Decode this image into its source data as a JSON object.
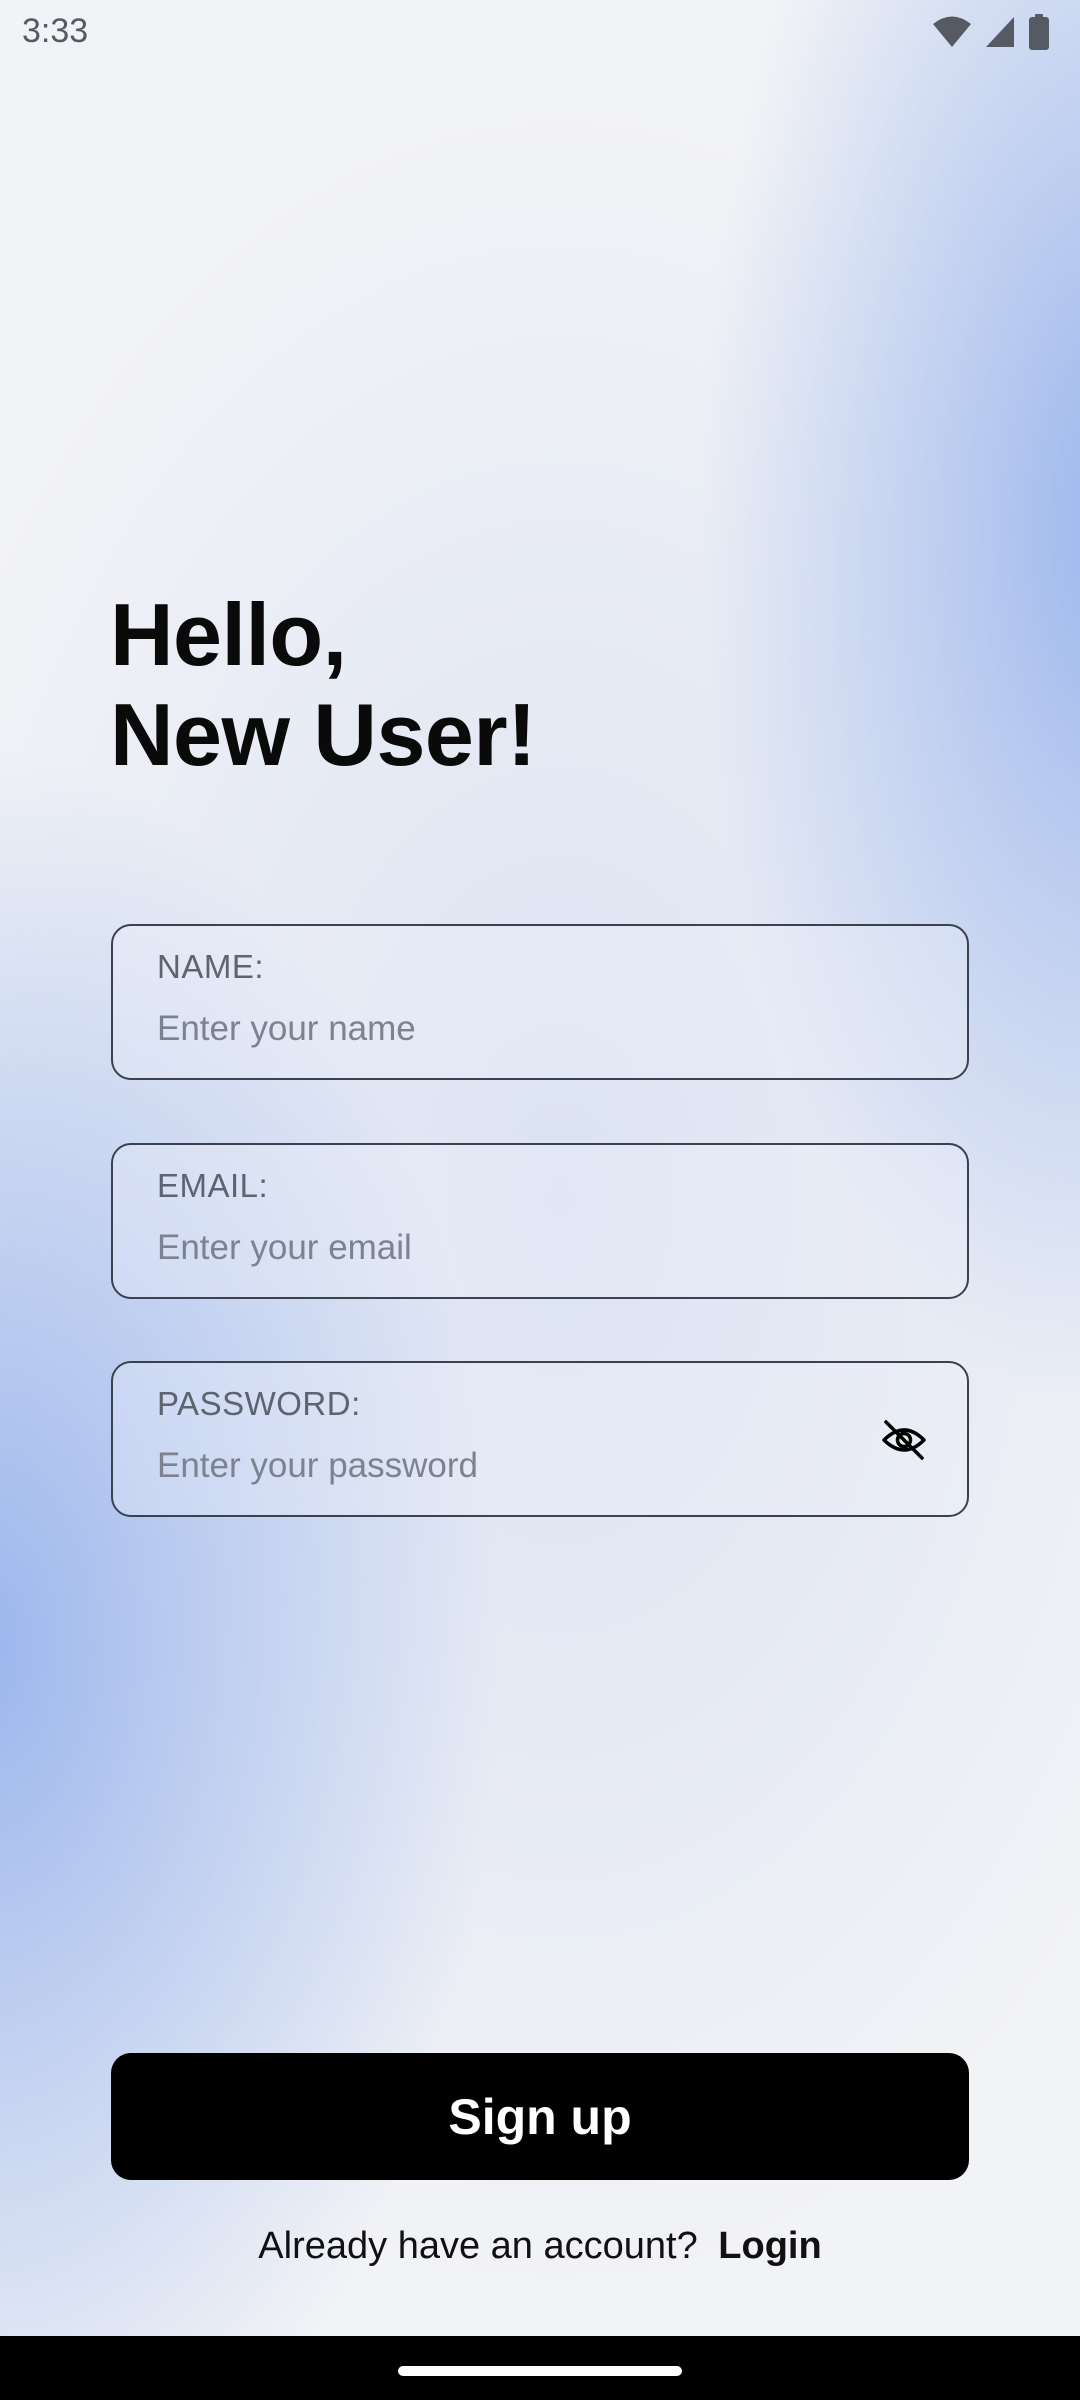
{
  "status_bar": {
    "time": "3:33",
    "icons": [
      "wifi-icon",
      "cellular-signal-icon",
      "battery-icon"
    ]
  },
  "greeting": {
    "line1": "Hello,",
    "line2": "New User!"
  },
  "form": {
    "name": {
      "label": "NAME:",
      "value": "",
      "placeholder": "Enter your name"
    },
    "email": {
      "label": "EMAIL:",
      "value": "",
      "placeholder": "Enter your email"
    },
    "password": {
      "label": "PASSWORD:",
      "value": "",
      "placeholder": "Enter your password",
      "toggle_icon": "eye-off-icon"
    }
  },
  "signup_button": {
    "label": "Sign up"
  },
  "login_prompt": {
    "text": "Already have an account?",
    "link": "Login"
  },
  "colors": {
    "accent_blue": "#96b2ec",
    "background": "#f2f3f6",
    "button": "#000000",
    "field_border": "#3c4150"
  }
}
